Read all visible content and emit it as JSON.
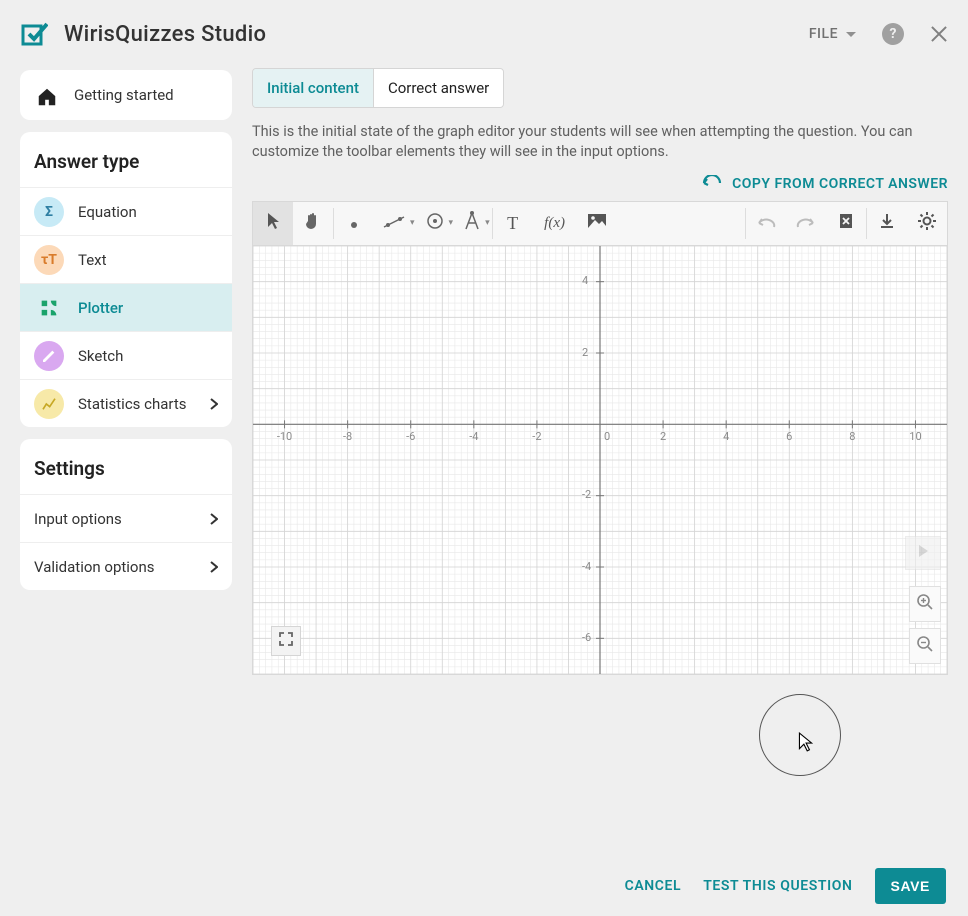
{
  "header": {
    "title": "WirisQuizzes Studio",
    "file_label": "FILE"
  },
  "sidebar": {
    "getting_started": "Getting started",
    "answer_type_header": "Answer type",
    "items": [
      {
        "label": "Equation"
      },
      {
        "label": "Text"
      },
      {
        "label": "Plotter"
      },
      {
        "label": "Sketch"
      },
      {
        "label": "Statistics charts"
      }
    ],
    "settings_header": "Settings",
    "settings_items": [
      {
        "label": "Input options"
      },
      {
        "label": "Validation options"
      }
    ]
  },
  "main": {
    "tabs": [
      {
        "label": "Initial content"
      },
      {
        "label": "Correct answer"
      }
    ],
    "description": "This is the initial state of the graph editor your students will see when attempting the question. You can customize the toolbar elements they will see in the input options.",
    "copy_label": "COPY FROM CORRECT ANSWER",
    "axes": {
      "x_ticks": [
        "-10",
        "-8",
        "-6",
        "-4",
        "-2",
        "0",
        "2",
        "4",
        "6",
        "8",
        "10"
      ],
      "y_ticks_pos": [
        "2",
        "4"
      ],
      "y_ticks_neg": [
        "-2",
        "-4",
        "-6"
      ],
      "x_range": [
        -11,
        11
      ],
      "y_range": [
        -7,
        5
      ]
    },
    "fx_label": "f(x)"
  },
  "footer": {
    "cancel": "CANCEL",
    "test": "TEST THIS QUESTION",
    "save": "SAVE"
  },
  "icons": {
    "equation": "Σ",
    "text": "τT",
    "help": "?"
  },
  "colors": {
    "accent": "#0d8b94"
  }
}
